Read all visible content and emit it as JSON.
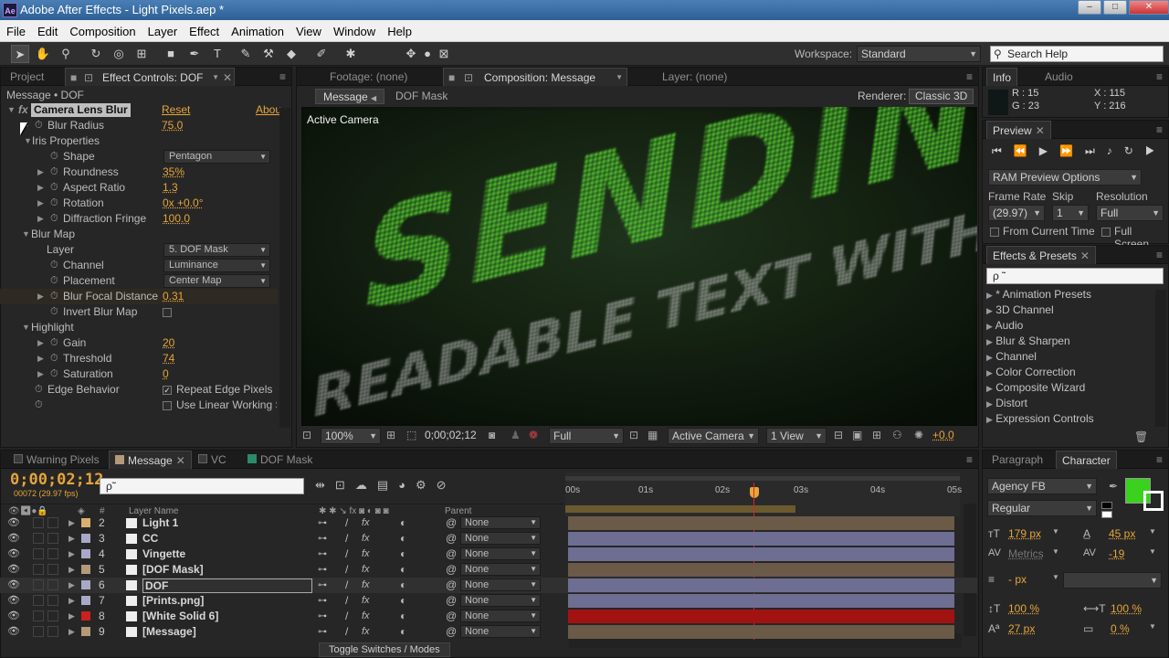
{
  "window": {
    "title": "Adobe After Effects - Light Pixels.aep *",
    "app_badge": "Ae",
    "controls": [
      "–",
      "□",
      "✕"
    ]
  },
  "menu": [
    "File",
    "Edit",
    "Composition",
    "Layer",
    "Effect",
    "Animation",
    "View",
    "Window",
    "Help"
  ],
  "toolbar": {
    "workspace_label": "Workspace:",
    "workspace_value": "Standard",
    "search_placeholder": "Search Help"
  },
  "project_panel": {
    "tabs": [
      "Project",
      "Effect Controls: DOF"
    ],
    "breadcrumb": "Message • DOF",
    "effect": {
      "name": "Camera Lens Blur",
      "reset": "Reset",
      "about": "Abou"
    },
    "properties": [
      {
        "label": "Blur Radius",
        "value": "75.0"
      },
      {
        "label": "Iris Properties",
        "value": ""
      },
      {
        "label": "Shape",
        "dropdown": "Pentagon"
      },
      {
        "label": "Roundness",
        "value": "35%"
      },
      {
        "label": "Aspect Ratio",
        "value": "1.3"
      },
      {
        "label": "Rotation",
        "value": "0x +0.0°"
      },
      {
        "label": "Diffraction Fringe",
        "value": "100.0"
      },
      {
        "label": "Blur Map",
        "value": ""
      },
      {
        "label": "Layer",
        "dropdown": "5. DOF Mask"
      },
      {
        "label": "Channel",
        "dropdown": "Luminance"
      },
      {
        "label": "Placement",
        "dropdown": "Center Map"
      },
      {
        "label": "Blur Focal Distance",
        "value": "0.31"
      },
      {
        "label": "Invert Blur Map",
        "value": ""
      },
      {
        "label": "Highlight",
        "value": ""
      },
      {
        "label": "Gain",
        "value": "20"
      },
      {
        "label": "Threshold",
        "value": "74"
      },
      {
        "label": "Saturation",
        "value": "0"
      },
      {
        "label": "Edge Behavior",
        "checkbox": "Repeat Edge Pixels"
      },
      {
        "label": "",
        "checkbox": "Use Linear Working S"
      }
    ]
  },
  "composition_panel": {
    "tabs": [
      "Footage: (none)",
      "Composition: Message",
      "Layer: (none)"
    ],
    "subtabs": [
      "Message",
      "DOF Mask"
    ],
    "renderer_label": "Renderer:",
    "renderer_value": "Classic 3D",
    "view_label": "Active Camera",
    "canvas_text_main": "SENDING...",
    "canvas_text_sub": "READABLE TEXT WITH WORDS",
    "bottom_bar": {
      "zoom": "100%",
      "timecode": "0;00;02;12",
      "resolution": "Full",
      "camera": "Active Camera",
      "views": "1 View",
      "exposure": "+0.0"
    }
  },
  "info_panel": {
    "tabs": [
      "Info",
      "Audio"
    ],
    "r": "R : 15",
    "g": "G : 23",
    "x": "X : 115",
    "y": "Y : 216"
  },
  "preview_panel": {
    "title": "Preview",
    "ram_options": "RAM Preview Options",
    "frame_rate_label": "Frame Rate",
    "skip_label": "Skip",
    "resolution_label": "Resolution",
    "frame_rate_value": "(29.97)",
    "skip_value": "1",
    "resolution_value": "Full",
    "from_current": "From Current Time",
    "full_screen": "Full Screen"
  },
  "effects_presets": {
    "title": "Effects & Presets",
    "search_placeholder": "ρ ˜",
    "items": [
      "* Animation Presets",
      "3D Channel",
      "Audio",
      "Blur & Sharpen",
      "Channel",
      "Color Correction",
      "Composite Wizard",
      "Distort",
      "Expression Controls"
    ]
  },
  "timeline": {
    "tabs": [
      "Warning Pixels",
      "Message",
      "VC",
      "DOF Mask"
    ],
    "timecode": "0;00;02;12",
    "fps_info": "00072 (29.97 fps)",
    "search_placeholder": "ρ˜",
    "columns": {
      "num": "#",
      "layer_name": "Layer Name",
      "parent": "Parent"
    },
    "ruler": [
      "00s",
      "01s",
      "02s",
      "03s",
      "04s",
      "05s"
    ],
    "layers": [
      {
        "num": "2",
        "name": "Light 1",
        "label_color": "#d9b070",
        "parent": "None"
      },
      {
        "num": "3",
        "name": "CC",
        "label_color": "#a8a8c8",
        "parent": "None"
      },
      {
        "num": "4",
        "name": "Vingette",
        "label_color": "#a8a8c8",
        "parent": "None"
      },
      {
        "num": "5",
        "name": "[DOF Mask]",
        "label_color": "#b49a78",
        "parent": "None"
      },
      {
        "num": "6",
        "name": "DOF",
        "label_color": "#a8a8c8",
        "parent": "None"
      },
      {
        "num": "7",
        "name": "[Prints.png]",
        "label_color": "#a8a8c8",
        "parent": "None"
      },
      {
        "num": "8",
        "name": "[White Solid 6]",
        "label_color": "#cc1f1f",
        "parent": "None"
      },
      {
        "num": "9",
        "name": "[Message]",
        "label_color": "#b49a78",
        "parent": "None"
      }
    ],
    "toggle_label": "Toggle Switches / Modes"
  },
  "character_panel": {
    "tabs": [
      "Paragraph",
      "Character"
    ],
    "font": "Agency FB",
    "style": "Regular",
    "size": "179 px",
    "leading": "45 px",
    "kerning": "Metrics",
    "tracking": "-19",
    "stroke": "- px",
    "vscale": "100 %",
    "hscale": "100 %",
    "baseline": "27 px",
    "tsume": "0 %"
  },
  "colors": {
    "accent_orange": "#e5a53a",
    "fill_green": "#3ad11f",
    "track_red": "#a31212",
    "track_tan": "#6b5a48",
    "track_lavender": "#6e6e92",
    "playhead": "#d9262b"
  }
}
